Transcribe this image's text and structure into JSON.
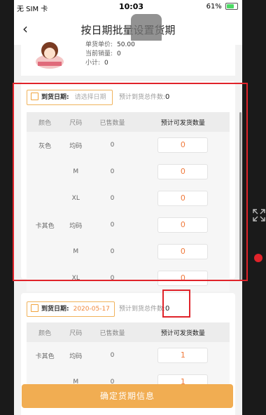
{
  "status_bar": {
    "carrier": "无 SIM 卡",
    "time": "10:03",
    "battery": "61%"
  },
  "nav": {
    "title": "按日期批量设置货期"
  },
  "product": {
    "unit_price_label": "单货单价:",
    "unit_price": "50.00",
    "sales_label": "当前销量:",
    "sales": "0",
    "subtotal_label": "小计:",
    "subtotal": "0"
  },
  "cards": [
    {
      "date_label": "到货日期:",
      "date_placeholder": "请选择日期",
      "date_value": "",
      "expect_label": "预计到货总件数:",
      "expect_value": "0",
      "headers": [
        "颜色",
        "尺码",
        "已售数量",
        "预计可发货数量"
      ],
      "rows": [
        {
          "color": "灰色",
          "size": "均码",
          "sold": "0",
          "qty": "0"
        },
        {
          "color": "",
          "size": "M",
          "sold": "0",
          "qty": "0"
        },
        {
          "color": "",
          "size": "XL",
          "sold": "0",
          "qty": "0"
        },
        {
          "color": "卡其色",
          "size": "均码",
          "sold": "0",
          "qty": "0"
        },
        {
          "color": "",
          "size": "M",
          "sold": "0",
          "qty": "0"
        },
        {
          "color": "",
          "size": "XL",
          "sold": "0",
          "qty": "0"
        }
      ]
    },
    {
      "date_label": "到货日期:",
      "date_placeholder": "",
      "date_value": "2020-05-17",
      "expect_label": "预计到货总件数:",
      "expect_value": "0",
      "headers": [
        "颜色",
        "尺码",
        "已售数量",
        "预计可发货数量"
      ],
      "rows": [
        {
          "color": "卡其色",
          "size": "均码",
          "sold": "0",
          "qty": "1"
        },
        {
          "color": "",
          "size": "M",
          "sold": "0",
          "qty": "1"
        }
      ]
    }
  ],
  "confirm_label": "确定货期信息",
  "colors": {
    "accent": "#f1ad52",
    "highlight": "#e0232a",
    "qty_text": "#f07a3c"
  }
}
